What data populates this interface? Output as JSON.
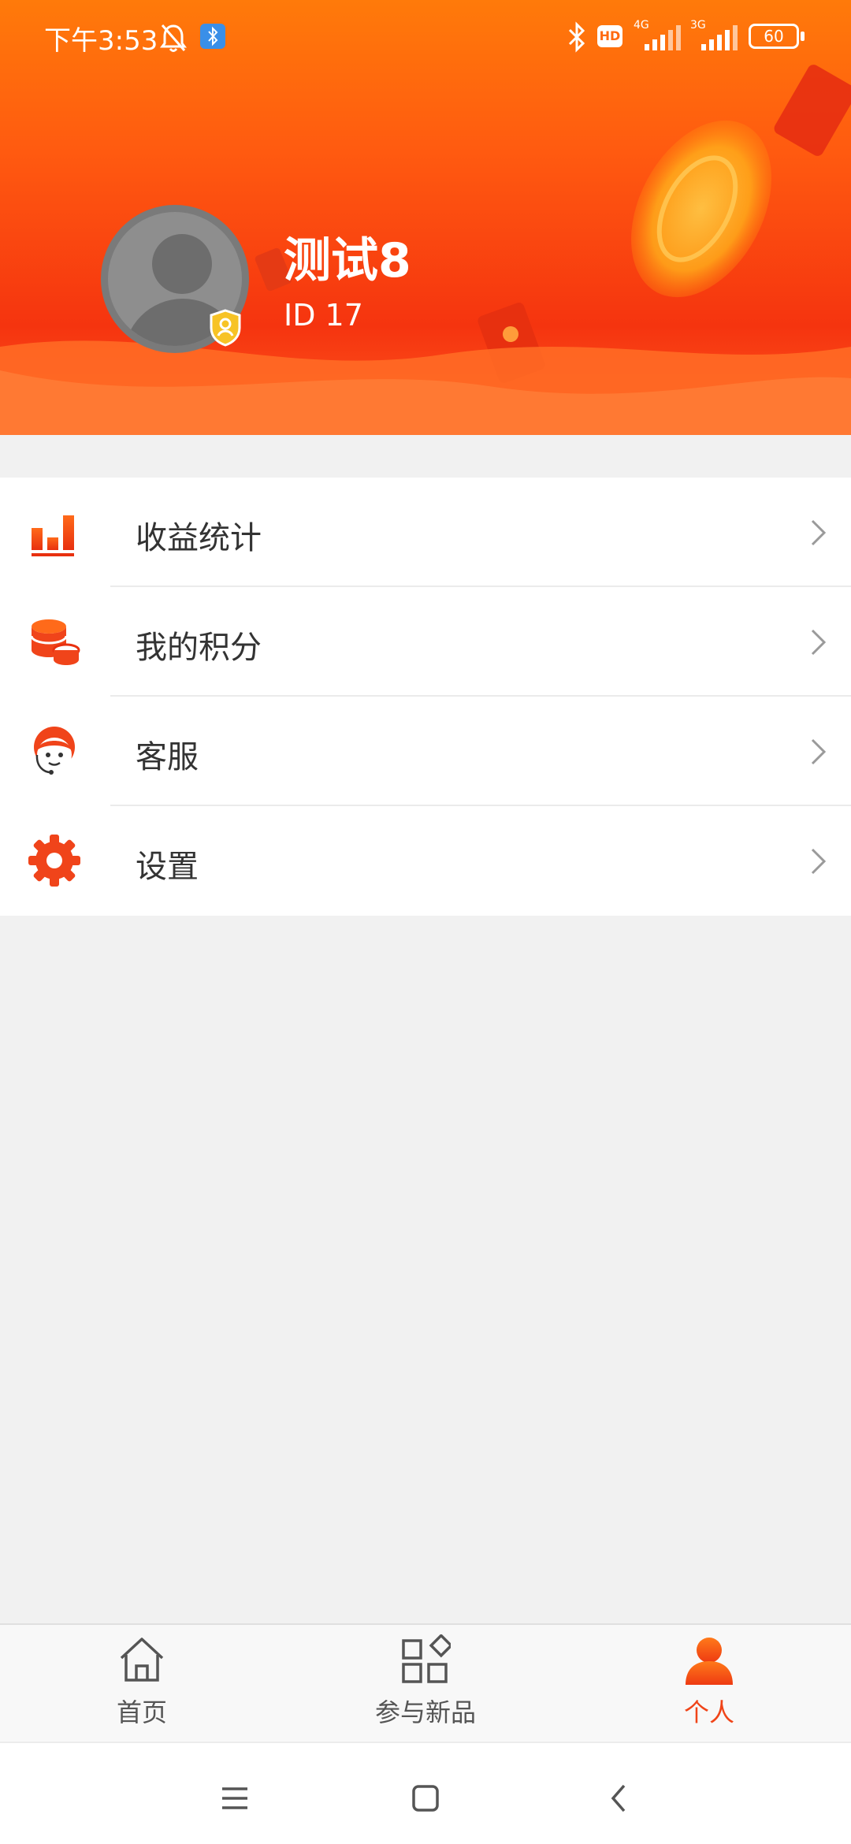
{
  "status_bar": {
    "time": "下午3:53",
    "network_1": "4G",
    "network_2": "3G",
    "battery": "60",
    "hd": "HD"
  },
  "profile": {
    "name": "测试8",
    "id_text": "ID 17"
  },
  "menu": {
    "items": [
      {
        "label": "收益统计",
        "icon": "bar-chart-icon"
      },
      {
        "label": "我的积分",
        "icon": "coins-icon"
      },
      {
        "label": "客服",
        "icon": "customer-service-icon"
      },
      {
        "label": "设置",
        "icon": "gear-icon"
      }
    ]
  },
  "tabbar": {
    "tabs": [
      {
        "label": "首页",
        "icon": "home-icon",
        "active": false
      },
      {
        "label": "参与新品",
        "icon": "grid-icon",
        "active": false
      },
      {
        "label": "个人",
        "icon": "person-icon",
        "active": true
      }
    ]
  },
  "colors": {
    "accent": "#f04418",
    "header_top": "#ff7a0a",
    "header_bottom": "#f5340f"
  }
}
